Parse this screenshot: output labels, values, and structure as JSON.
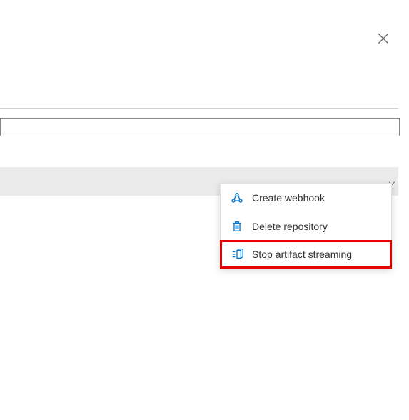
{
  "close": {
    "label": "Close"
  },
  "menu": {
    "items": [
      {
        "icon": "webhook",
        "label": "Create webhook"
      },
      {
        "icon": "delete",
        "label": "Delete repository"
      },
      {
        "icon": "stop-stream",
        "label": "Stop artifact streaming"
      }
    ]
  },
  "colors": {
    "accent": "#0078d4",
    "highlight_border": "#e60000"
  }
}
